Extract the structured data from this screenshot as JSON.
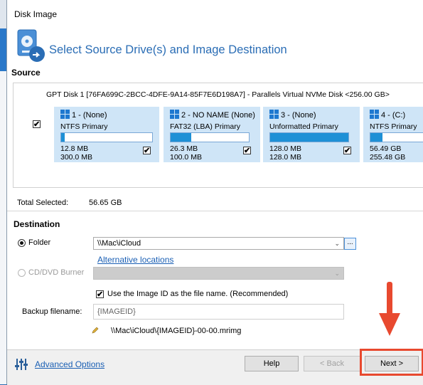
{
  "window": {
    "title": "Disk Image"
  },
  "header": {
    "title": "Select Source Drive(s) and Image Destination",
    "icon": "disk-image-icon"
  },
  "source": {
    "label": "Source",
    "disk_header": "GPT Disk 1 [76FA699C-2BCC-4DFE-9A14-85F7E6D198A7] - Parallels Virtual NVMe Disk  <256.00 GB>",
    "disk_checked": true,
    "partitions": [
      {
        "name": "1 -  (None)",
        "type": "NTFS Primary",
        "used": "12.8 MB",
        "total": "300.0 MB",
        "fill_percent": 4,
        "checked": true
      },
      {
        "name": "2 - NO NAME (None)",
        "type": "FAT32 (LBA) Primary",
        "used": "26.3 MB",
        "total": "100.0 MB",
        "fill_percent": 26,
        "checked": true
      },
      {
        "name": "3 -  (None)",
        "type": "Unformatted Primary",
        "used": "128.0 MB",
        "total": "128.0 MB",
        "fill_percent": 100,
        "checked": true
      },
      {
        "name": "4 -  (C:)",
        "type": "NTFS Primary",
        "used": "56.49 GB",
        "total": "255.48 GB",
        "fill_percent": 22,
        "checked": true
      }
    ],
    "total_selected_label": "Total Selected:",
    "total_selected_value": "56.65 GB"
  },
  "destination": {
    "label": "Destination",
    "folder_label": "Folder",
    "folder_value": "\\\\Mac\\iCloud",
    "browse_label": "...",
    "alt_locations": "Alternative locations",
    "cd_label": "CD/DVD Burner",
    "use_image_id_label": "Use the Image ID as the file name.  (Recommended)",
    "use_image_id_checked": true,
    "backup_filename_label": "Backup filename:",
    "backup_filename_placeholder": "{IMAGEID}",
    "resulting_path": "\\\\Mac\\iCloud\\{IMAGEID}-00-00.mrimg"
  },
  "footer": {
    "advanced_options": "Advanced Options",
    "help": "Help",
    "back": "< Back",
    "next": "Next >"
  },
  "colors": {
    "accent": "#2a6db5",
    "bar_fill": "#1e90d6",
    "partition_bg": "#cfe5f7",
    "annotation": "#e8492f"
  }
}
